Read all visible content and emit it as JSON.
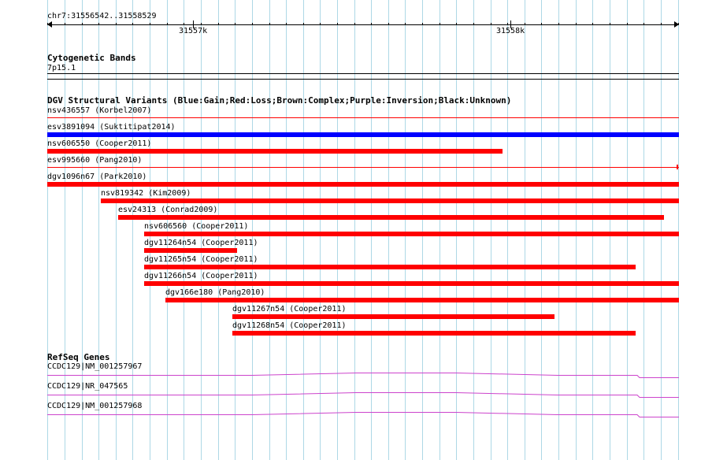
{
  "ruler": {
    "location": "chr7:31556542..31558529",
    "ticks": [
      {
        "label": "31557k",
        "pos": 31557000
      },
      {
        "label": "31558k",
        "pos": 31558000
      }
    ]
  },
  "view": {
    "start": 31556542,
    "end": 31558529
  },
  "cytobands": {
    "title": "Cytogenetic Bands",
    "band": "7p15.1"
  },
  "dgv": {
    "title": "DGV Structural Variants (Blue:Gain;Red:Loss;Brown:Complex;Purple:Inversion;Black:Unknown)",
    "colors": {
      "gain": "#0000ff",
      "loss": "#ff0000"
    },
    "variants": [
      {
        "label": "nsv436557 (Korbel2007)",
        "type": "loss",
        "start": 31556542,
        "end": 31558529,
        "style": "thin"
      },
      {
        "label": "esv3891094 (Suktitipat2014)",
        "type": "gain",
        "start": 31556542,
        "end": 31558529,
        "style": "thick"
      },
      {
        "label": "nsv606550 (Cooper2011)",
        "type": "loss",
        "start": 31556542,
        "end": 31557975,
        "style": "thick"
      },
      {
        "label": "esv995660 (Pang2010)",
        "type": "loss",
        "start": 31556542,
        "end": 31558529,
        "style": "thin-end"
      },
      {
        "label": "dgv1096n67 (Park2010)",
        "type": "loss",
        "start": 31556542,
        "end": 31558529,
        "style": "thick"
      },
      {
        "label": "nsv819342 (Kim2009)",
        "type": "loss",
        "start": 31556711,
        "end": 31558529,
        "style": "thick"
      },
      {
        "label": "esv24313 (Conrad2009)",
        "type": "loss",
        "start": 31556765,
        "end": 31558482,
        "style": "thick"
      },
      {
        "label": "nsv606560 (Cooper2011)",
        "type": "loss",
        "start": 31556847,
        "end": 31558529,
        "style": "thick"
      },
      {
        "label": "dgv11264n54 (Cooper2011)",
        "type": "loss",
        "start": 31556847,
        "end": 31557138,
        "style": "thick"
      },
      {
        "label": "dgv11265n54 (Cooper2011)",
        "type": "loss",
        "start": 31556847,
        "end": 31558393,
        "style": "thick"
      },
      {
        "label": "dgv11266n54 (Cooper2011)",
        "type": "loss",
        "start": 31556847,
        "end": 31558529,
        "style": "thick"
      },
      {
        "label": "dgv166e180 (Pang2010)",
        "type": "loss",
        "start": 31556914,
        "end": 31558529,
        "style": "thick"
      },
      {
        "label": "dgv11267n54 (Cooper2011)",
        "type": "loss",
        "start": 31557125,
        "end": 31558137,
        "style": "thick"
      },
      {
        "label": "dgv11268n54 (Cooper2011)",
        "type": "loss",
        "start": 31557125,
        "end": 31558393,
        "style": "thick"
      }
    ]
  },
  "refseq": {
    "title": "RefSeq Genes",
    "color": "#cc44cc",
    "genes": [
      {
        "label": "CCDC129|NM_001257967"
      },
      {
        "label": "CCDC129|NR_047565"
      },
      {
        "label": "CCDC129|NM_001257968"
      }
    ]
  }
}
